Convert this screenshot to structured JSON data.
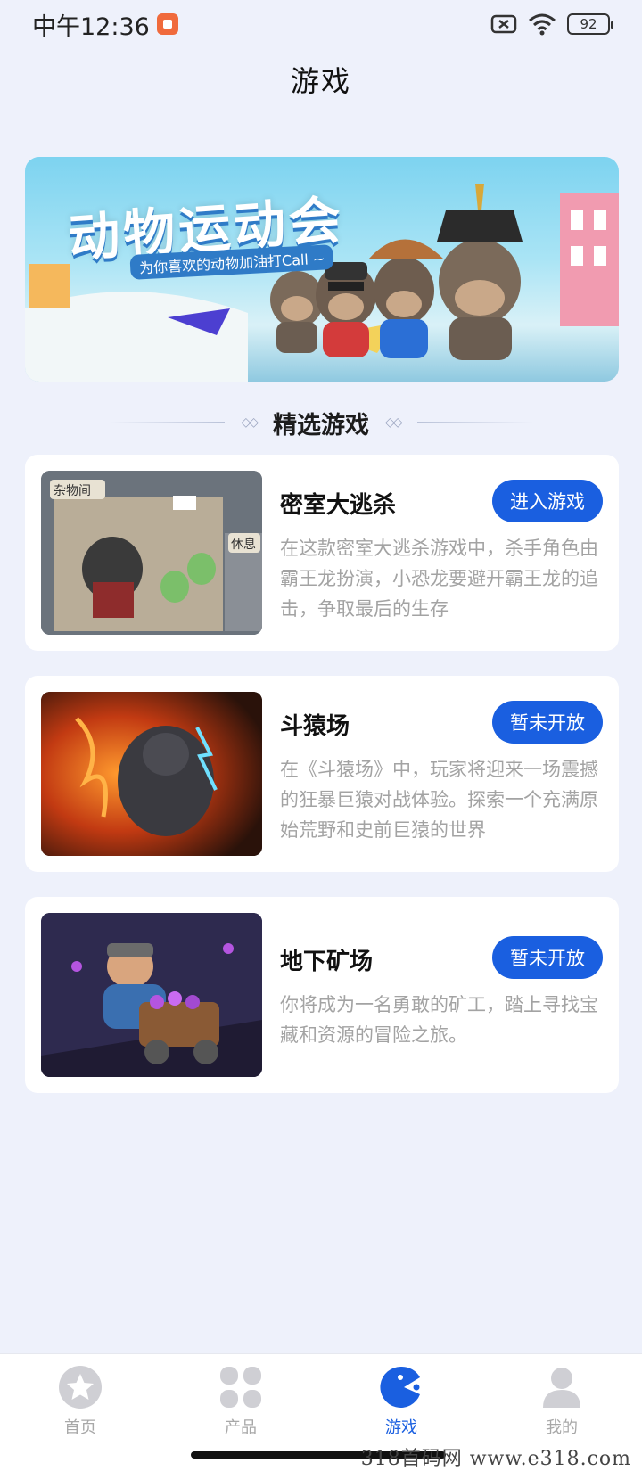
{
  "status_bar": {
    "time": "中午12:36",
    "battery": "92",
    "icons": [
      "record-icon",
      "sim-off-icon",
      "wifi-icon",
      "battery-icon"
    ]
  },
  "header": {
    "title": "游戏"
  },
  "banner": {
    "title": "动物运动会",
    "subtitle": "为你喜欢的动物加油打Call ~"
  },
  "section": {
    "title": "精选游戏"
  },
  "games": [
    {
      "name": "密室大逃杀",
      "button": "进入游戏",
      "description": "在这款密室大逃杀游戏中，杀手角色由霸王龙扮演，小恐龙要避开霸王龙的追击，争取最后的生存",
      "thumb_labels": [
        "杂物间",
        "休息"
      ]
    },
    {
      "name": "斗猿场",
      "button": "暂未开放",
      "description": "在《斗猿场》中，玩家将迎来一场震撼的狂暴巨猿对战体验。探索一个充满原始荒野和史前巨猿的世界"
    },
    {
      "name": "地下矿场",
      "button": "暂未开放",
      "description": "你将成为一名勇敢的矿工，踏上寻找宝藏和资源的冒险之旅。"
    }
  ],
  "tabbar": {
    "tabs": [
      {
        "label": "首页",
        "icon": "star-icon"
      },
      {
        "label": "产品",
        "icon": "grid-icon"
      },
      {
        "label": "游戏",
        "icon": "game-icon",
        "active": true
      },
      {
        "label": "我的",
        "icon": "profile-icon"
      }
    ],
    "active_color": "#1a5fe0",
    "inactive_color": "#a8a8a8"
  },
  "watermark": "318首码网 www.e318.com"
}
